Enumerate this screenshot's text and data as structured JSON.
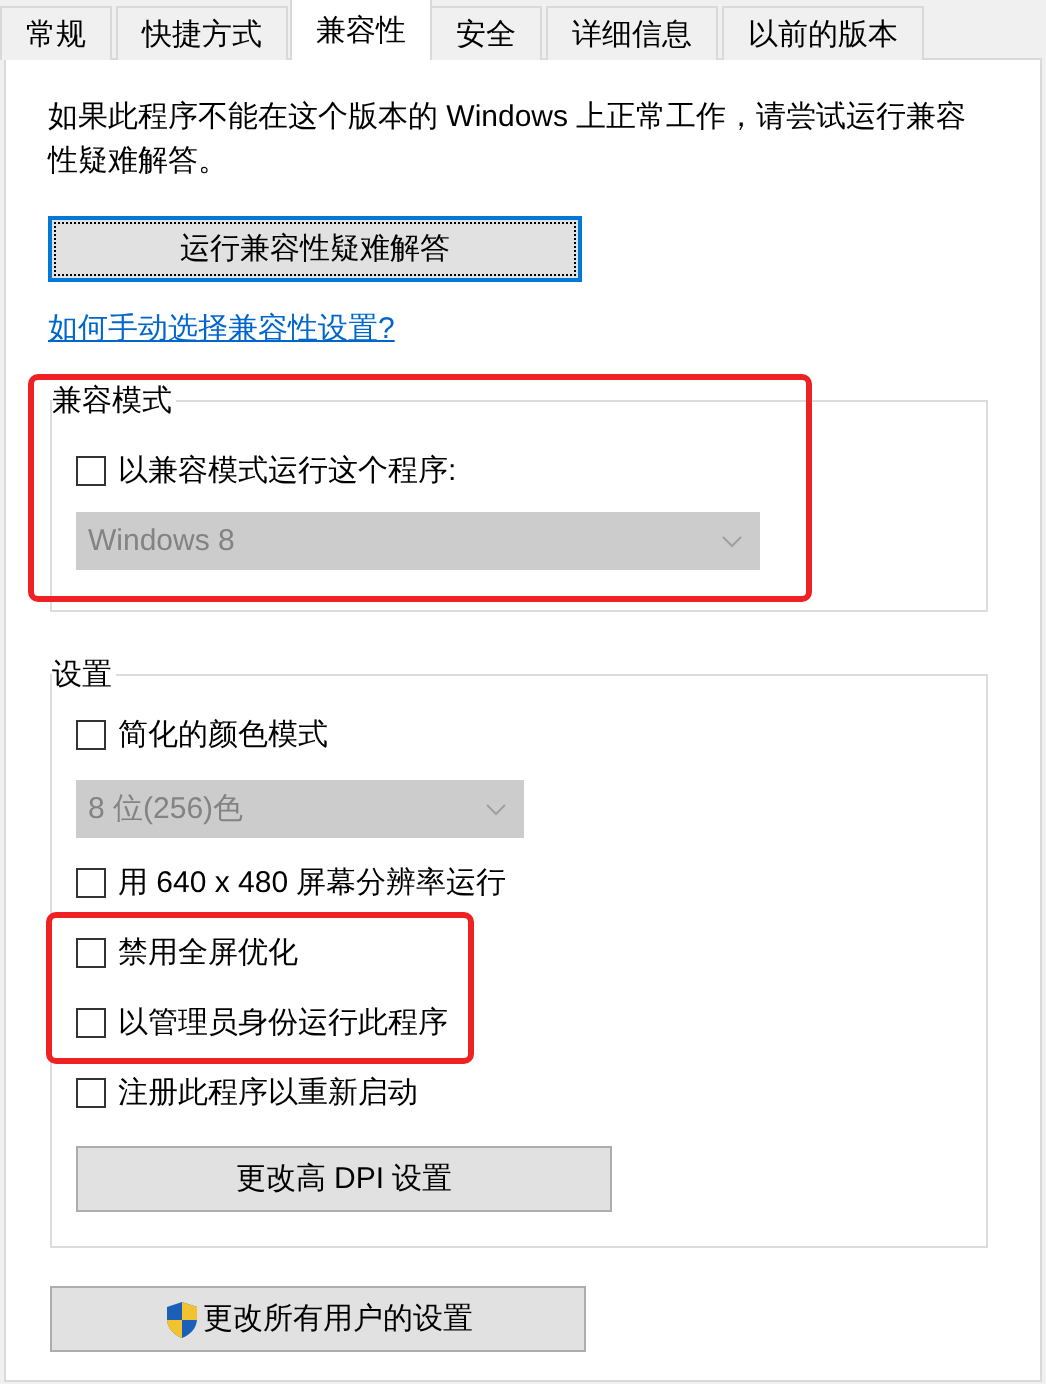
{
  "tabs": [
    {
      "label": "常规",
      "selected": false
    },
    {
      "label": "快捷方式",
      "selected": false
    },
    {
      "label": "兼容性",
      "selected": true
    },
    {
      "label": "安全",
      "selected": false
    },
    {
      "label": "详细信息",
      "selected": false
    },
    {
      "label": "以前的版本",
      "selected": false
    }
  ],
  "intro": "如果此程序不能在这个版本的 Windows 上正常工作，请尝试运行兼容性疑难解答。",
  "troubleshoot_button": {
    "label": "运行兼容性疑难解答",
    "focused": true
  },
  "help_link": "如何手动选择兼容性设置?",
  "compat_mode": {
    "title": "兼容模式",
    "highlighted": true,
    "checkbox": {
      "label": "以兼容模式运行这个程序:",
      "checked": false
    },
    "dropdown": {
      "value": "Windows 8",
      "disabled": true
    }
  },
  "settings": {
    "title": "设置",
    "items": [
      {
        "kind": "checkbox",
        "label": "简化的颜色模式",
        "checked": false,
        "highlighted": false
      },
      {
        "kind": "dropdown",
        "value": "8 位(256)色",
        "disabled": true
      },
      {
        "kind": "checkbox",
        "label": "用 640 x 480 屏幕分辨率运行",
        "checked": false,
        "highlighted": false
      },
      {
        "kind": "checkbox",
        "label": "禁用全屏优化",
        "checked": false,
        "highlighted": true
      },
      {
        "kind": "checkbox",
        "label": "以管理员身份运行此程序",
        "checked": false,
        "highlighted": true
      },
      {
        "kind": "checkbox",
        "label": "注册此程序以重新启动",
        "checked": false,
        "highlighted": false
      },
      {
        "kind": "button",
        "label": "更改高 DPI 设置"
      }
    ]
  },
  "all_users_button": {
    "label": "更改所有用户的设置"
  }
}
